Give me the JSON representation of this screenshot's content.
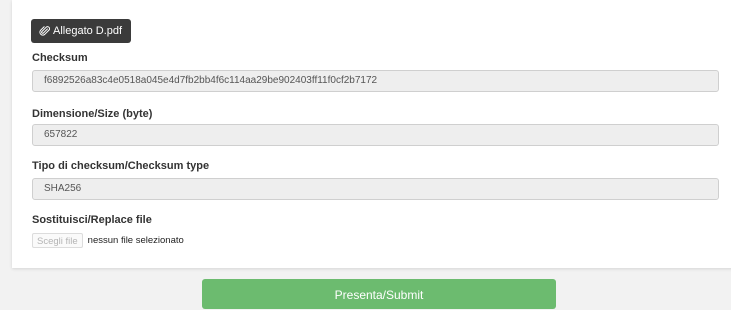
{
  "attachment": {
    "label": "Allegato D.pdf",
    "icon": "paperclip-icon"
  },
  "fields": {
    "checksum": {
      "label": "Checksum",
      "value": "f6892526a83c4e0518a045e4d7fb2bb4f6c114aa29be902403ff11f0cf2b7172"
    },
    "size": {
      "label": "Dimensione/Size (byte)",
      "value": "657822"
    },
    "checksum_type": {
      "label": "Tipo di checksum/Checksum type",
      "value": "SHA256"
    }
  },
  "replace_file": {
    "label": "Sostituisci/Replace file",
    "button_label": "Scegli file",
    "status_text": "nessun file selezionato"
  },
  "submit": {
    "label": "Presenta/Submit"
  },
  "colors": {
    "submit_green": "#6cbb6f",
    "attach_button_dark": "#3b3b3b",
    "field_bg": "#eeeeee"
  }
}
